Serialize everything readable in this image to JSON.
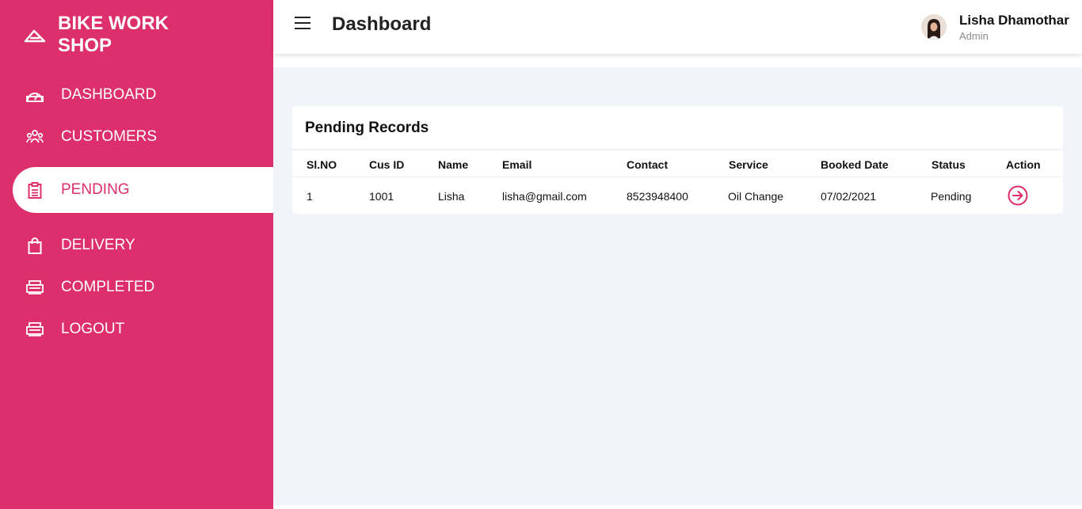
{
  "brand": {
    "name": "BIKE WORK SHOP",
    "icon": "road-icon"
  },
  "sidebar": {
    "items": [
      {
        "label": "DASHBOARD",
        "icon": "dashboard-icon",
        "active": false
      },
      {
        "label": "CUSTOMERS",
        "icon": "users-icon",
        "active": false
      },
      {
        "label": "PENDING",
        "icon": "clipboard-icon",
        "active": true
      },
      {
        "label": "DELIVERY",
        "icon": "shopping-bag-icon",
        "active": false
      },
      {
        "label": "COMPLETED",
        "icon": "printer-icon",
        "active": false
      },
      {
        "label": "LOGOUT",
        "icon": "printer-icon",
        "active": false
      }
    ]
  },
  "header": {
    "title": "Dashboard",
    "menu_icon": "hamburger-icon",
    "user": {
      "name": "Lisha Dhamothar",
      "role": "Admin"
    }
  },
  "records": {
    "title": "Pending Records",
    "columns": [
      "Sl.NO",
      "Cus ID",
      "Name",
      "Email",
      "Contact",
      "Service",
      "Booked Date",
      "Status",
      "Action"
    ],
    "rows": [
      {
        "slno": "1",
        "cus_id": "1001",
        "name": "Lisha",
        "email": "lisha@gmail.com",
        "contact": "8523948400",
        "service": "Oil Change",
        "booked_date": "07/02/2021",
        "status": "Pending",
        "action_icon": "arrow-circle-right-icon"
      }
    ]
  },
  "colors": {
    "brand": "#dc2f6c",
    "content_bg": "#f0f3f8",
    "text": "#111111"
  }
}
